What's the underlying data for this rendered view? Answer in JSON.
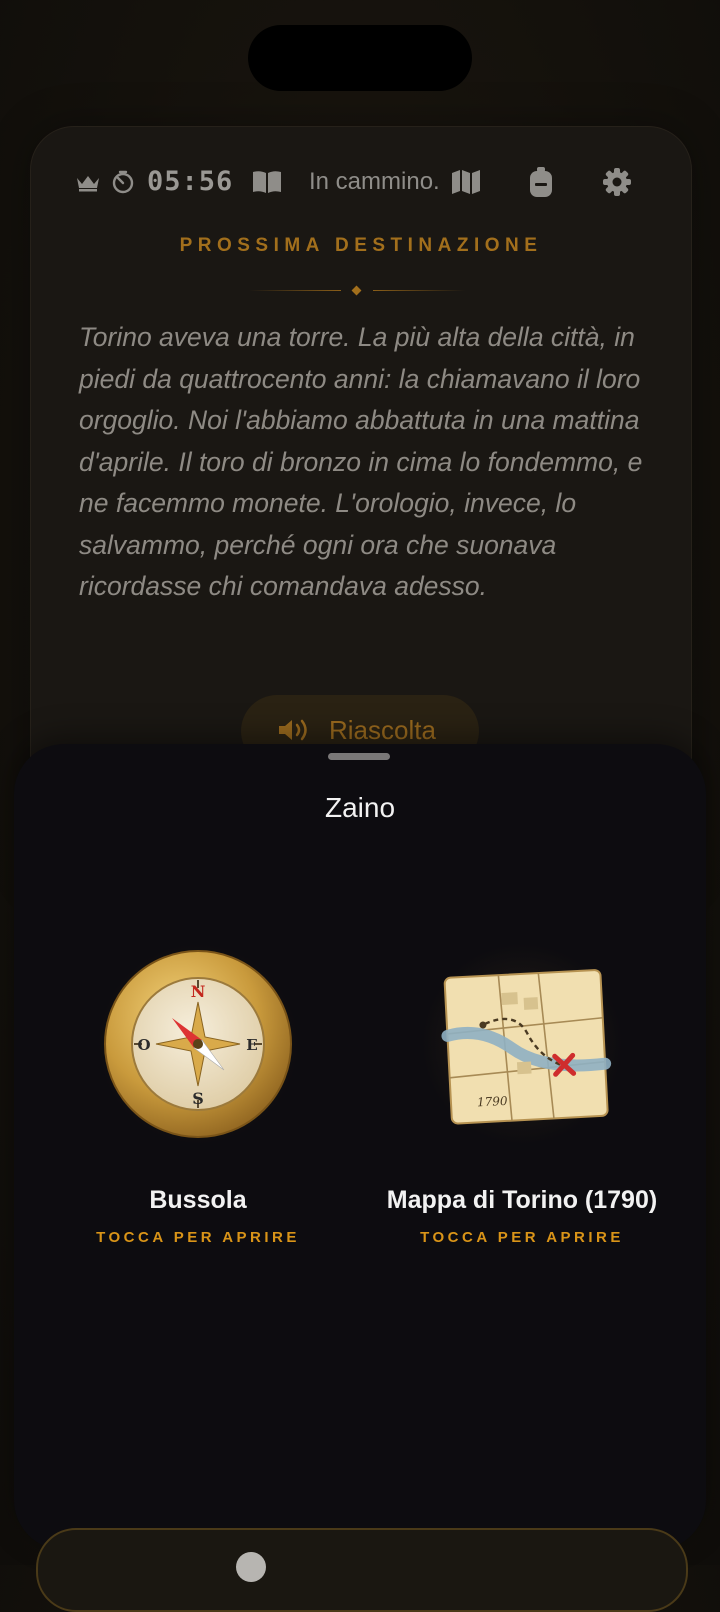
{
  "header": {
    "timer": "05:56",
    "status": "In cammino."
  },
  "card": {
    "eyebrow": "PROSSIMA DESTINAZIONE",
    "story": "Torino aveva una torre. La più alta della città, in piedi da quattrocento anni: la chiamavano il loro orgoglio. Noi l'abbiamo abbattuta in una mattina d'aprile. Il toro di bronzo in cima lo fondemmo, e ne facemmo monete. L'orologio, invece, lo salvammo, perché ogni ora che suonava ricordasse chi comandava adesso.",
    "replay_label": "Riascolta"
  },
  "sheet": {
    "title": "Zaino",
    "items": [
      {
        "name": "Bussola",
        "hint": "TOCCA PER APRIRE",
        "icon": "compass-icon",
        "compass_letters": {
          "n": "N",
          "s": "S",
          "e": "E",
          "o": "O"
        }
      },
      {
        "name": "Mappa di Torino (1790)",
        "hint": "TOCCA PER APRIRE",
        "icon": "map-icon",
        "map_year": "1790"
      }
    ]
  },
  "colors": {
    "accent": "#a26f1c",
    "hint": "#d99418",
    "sheet_bg": "#0d0c10",
    "card_bg": "#1a1713"
  }
}
